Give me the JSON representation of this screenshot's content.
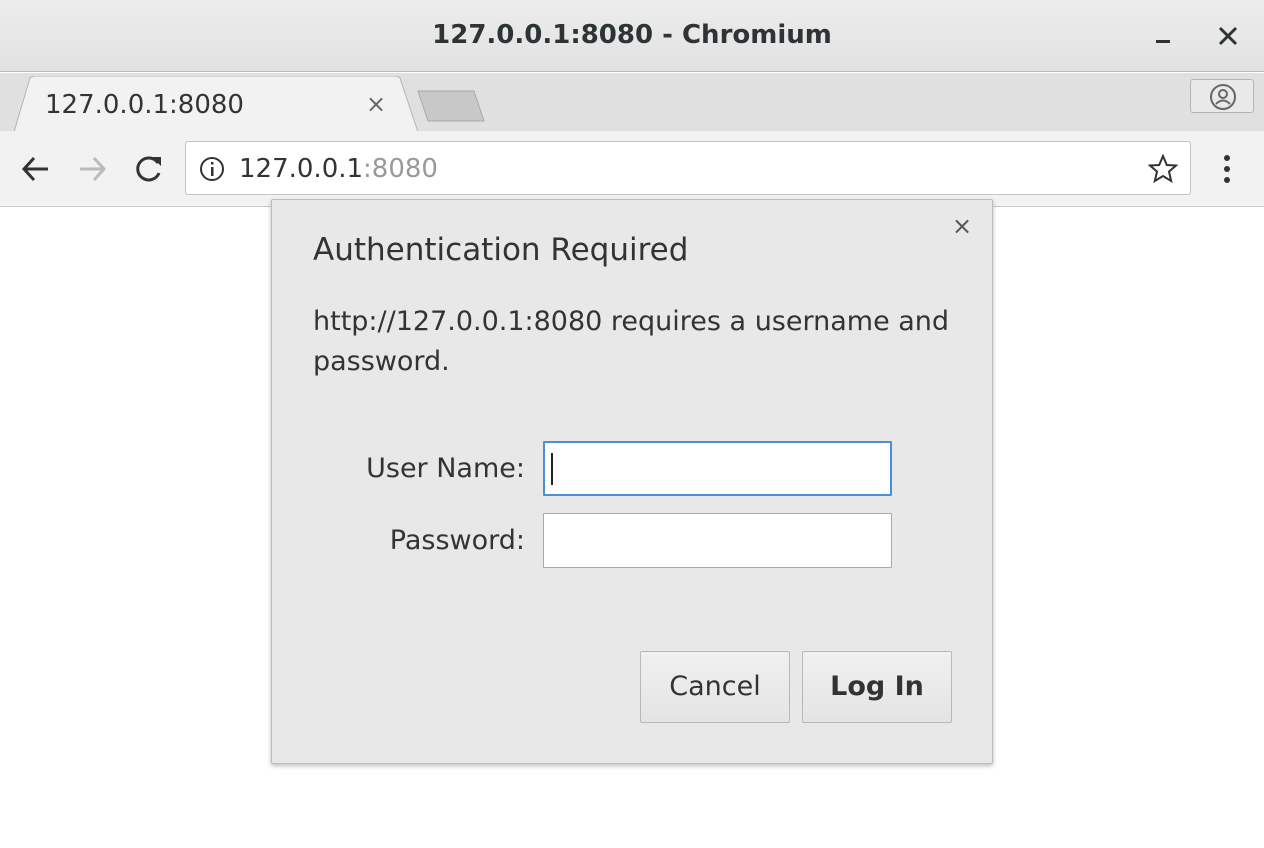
{
  "window": {
    "title": "127.0.0.1:8080 - Chromium",
    "minimize_label": "–",
    "close_label": "✕"
  },
  "tabs": [
    {
      "title": "127.0.0.1:8080",
      "close_label": "×"
    }
  ],
  "toolbar": {
    "back_icon": "back-arrow-icon",
    "forward_icon": "forward-arrow-icon",
    "reload_icon": "reload-icon",
    "url_host": "127.0.0.1",
    "url_port": ":8080",
    "bookmark_icon": "star-icon",
    "menu_icon": "kebab-menu-icon"
  },
  "dialog": {
    "title": "Authentication Required",
    "message": "http://127.0.0.1:8080 requires a username and password.",
    "close_label": "×",
    "username_label": "User Name:",
    "username_value": "",
    "password_label": "Password:",
    "password_value": "",
    "cancel_label": "Cancel",
    "login_label": "Log In"
  },
  "colors": {
    "focus_border": "#4a90d9",
    "dialog_bg": "#e8e8e8"
  }
}
